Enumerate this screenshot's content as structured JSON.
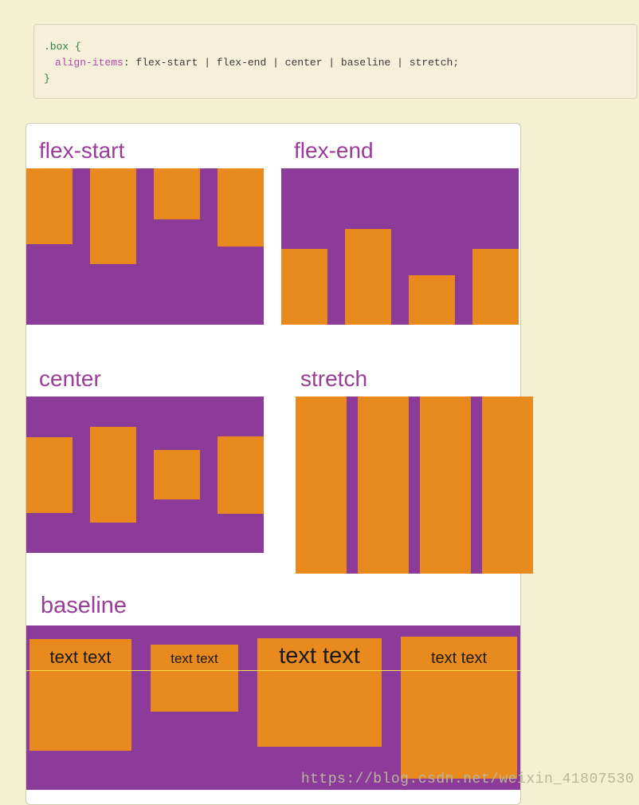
{
  "code": {
    "selector": ".box",
    "brace_open": "{",
    "property": "align-items",
    "colon": ":",
    "value": "flex-start | flex-end | center | baseline | stretch",
    "semicolon": ";",
    "brace_close": "}"
  },
  "labels": {
    "flex_start": "flex-start",
    "flex_end": "flex-end",
    "center": "center",
    "stretch": "stretch",
    "baseline": "baseline"
  },
  "baseline_items": {
    "b1": "text text",
    "b2": "text text",
    "b3": "text text",
    "b4": "text text"
  },
  "watermark": "https://blog.csdn.net/weixin_41807530"
}
